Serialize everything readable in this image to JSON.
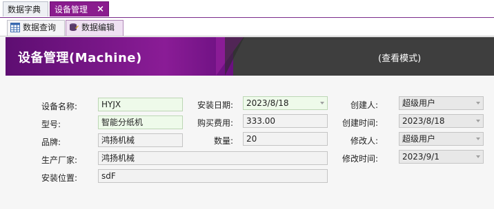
{
  "top_tabs": [
    {
      "label": "数据字典"
    },
    {
      "label": "设备管理",
      "close": "×"
    }
  ],
  "sub_tabs": [
    {
      "label": "数据查询",
      "icon": "grid-icon"
    },
    {
      "label": "数据编辑",
      "icon": "database-icon"
    }
  ],
  "header": {
    "title": "设备管理(Machine)",
    "mode": "(查看模式)"
  },
  "form": {
    "name_label": "设备名称:",
    "name_value": "HYJX",
    "model_label": "型号:",
    "model_value": "智能分纸机",
    "brand_label": "品牌:",
    "brand_value": "鸿扬机械",
    "maker_label": "生产厂家:",
    "maker_value": "鸿扬机械",
    "location_label": "安装位置:",
    "location_value": "sdF",
    "install_date_label": "安装日期:",
    "install_date_value": "2023/8/18",
    "cost_label": "购买费用:",
    "cost_value": "333.00",
    "qty_label": "数量:",
    "qty_value": "20",
    "creator_label": "创建人:",
    "creator_value": "超级用户",
    "created_label": "创建时间:",
    "created_value": "2023/8/18",
    "modifier_label": "修改人:",
    "modifier_value": "超级用户",
    "modified_label": "修改时间:",
    "modified_value": "2023/9/1"
  },
  "colors": {
    "accent": "#8a1c96",
    "header_dark": "#3e3e3e",
    "field_green": "#eefaea"
  }
}
